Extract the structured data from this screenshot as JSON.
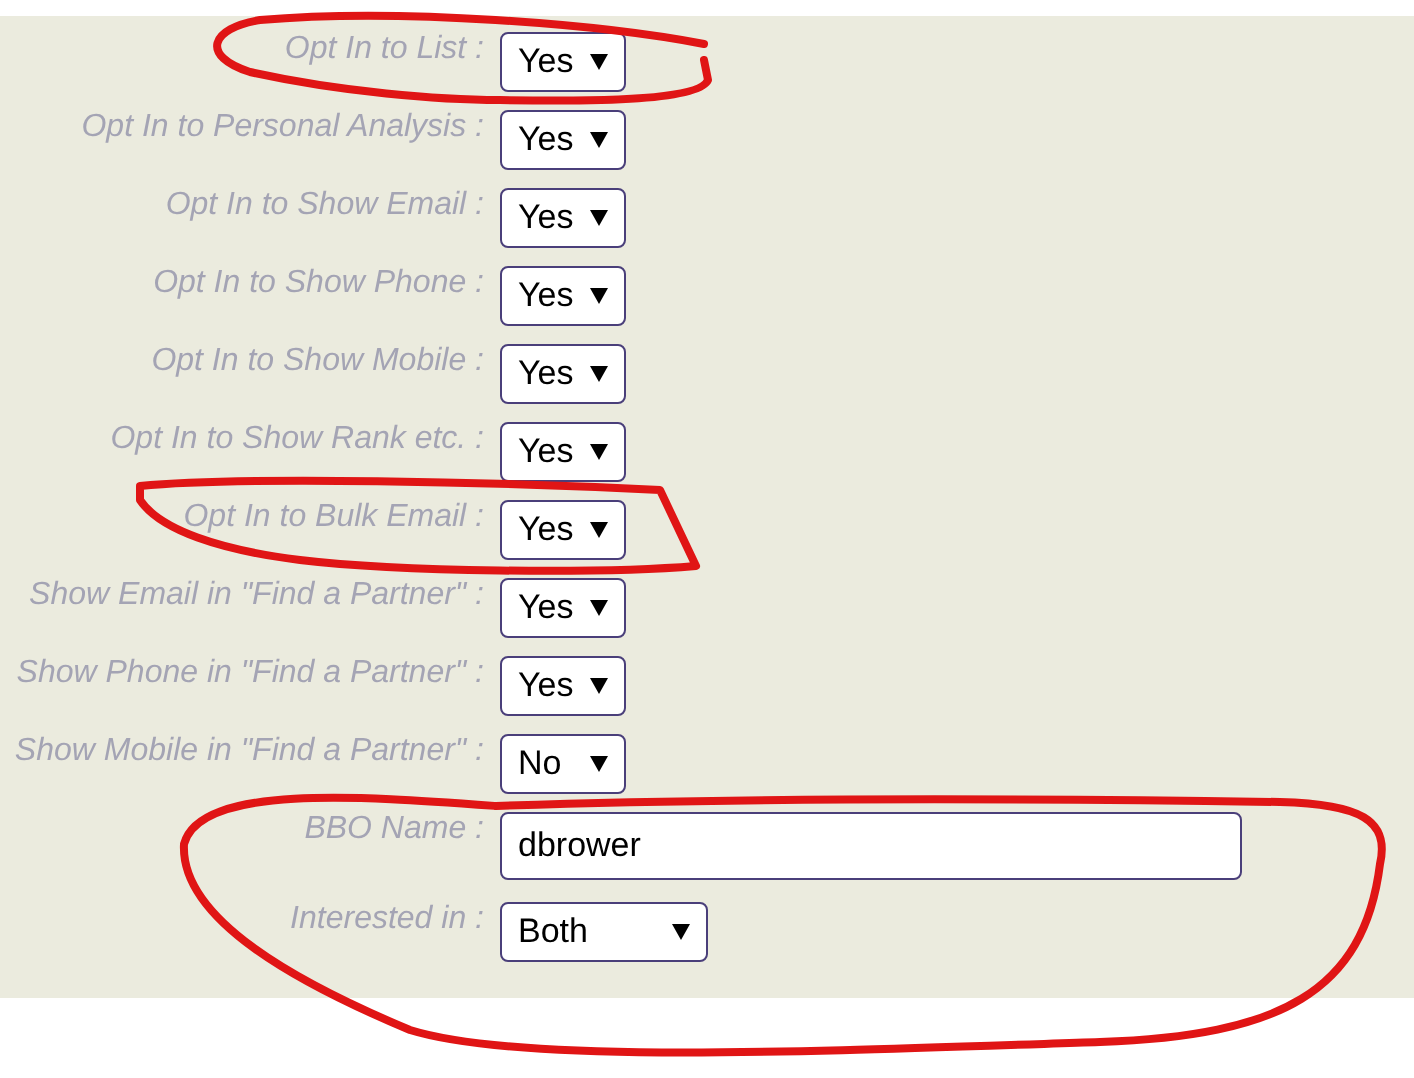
{
  "form": {
    "fields": [
      {
        "kind": "select",
        "label": "Opt In to List :",
        "value": "Yes"
      },
      {
        "kind": "select",
        "label": "Opt In to Personal Analysis :",
        "value": "Yes"
      },
      {
        "kind": "select",
        "label": "Opt In to Show Email :",
        "value": "Yes"
      },
      {
        "kind": "select",
        "label": "Opt In to Show Phone :",
        "value": "Yes"
      },
      {
        "kind": "select",
        "label": "Opt In to Show Mobile :",
        "value": "Yes"
      },
      {
        "kind": "select",
        "label": "Opt In to Show Rank etc. :",
        "value": "Yes"
      },
      {
        "kind": "select",
        "label": "Opt In to Bulk Email :",
        "value": "Yes"
      },
      {
        "kind": "select",
        "label": "Show Email in \"Find a Partner\" :",
        "value": "Yes"
      },
      {
        "kind": "select",
        "label": "Show Phone in \"Find a Partner\" :",
        "value": "Yes"
      },
      {
        "kind": "select",
        "label": "Show Mobile in \"Find a Partner\" :",
        "value": "No"
      },
      {
        "kind": "text",
        "label": "BBO Name :",
        "value": "dbrower"
      },
      {
        "kind": "wide-select",
        "label": "Interested in :",
        "value": "Both"
      }
    ]
  }
}
